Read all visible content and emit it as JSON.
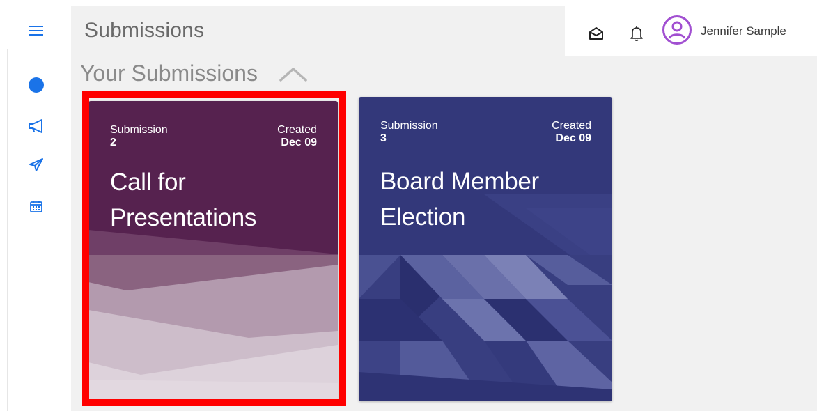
{
  "page": {
    "title": "Submissions"
  },
  "section": {
    "title": "Your Submissions"
  },
  "sidebar": {
    "items": [
      {
        "icon": "menu-icon"
      },
      {
        "icon": "dot-icon"
      },
      {
        "icon": "megaphone-icon"
      },
      {
        "icon": "paper-plane-icon"
      },
      {
        "icon": "calendar-icon"
      }
    ]
  },
  "topbar": {
    "user_name": "Jennifer Sample",
    "icons": [
      "envelope-open-icon",
      "bell-icon",
      "user-avatar-icon"
    ]
  },
  "cards": [
    {
      "label": "Submission",
      "number": "2",
      "created_label": "Created",
      "date": "Dec 09",
      "title": "Call for Presentations",
      "color": "#56224f"
    },
    {
      "label": "Submission",
      "number": "3",
      "created_label": "Created",
      "date": "Dec 09",
      "title": "Board Member Election",
      "color": "#33387a"
    }
  ],
  "colors": {
    "accent": "#1a73e8",
    "avatar": "#a14fd1",
    "highlight": "#ff0000"
  }
}
